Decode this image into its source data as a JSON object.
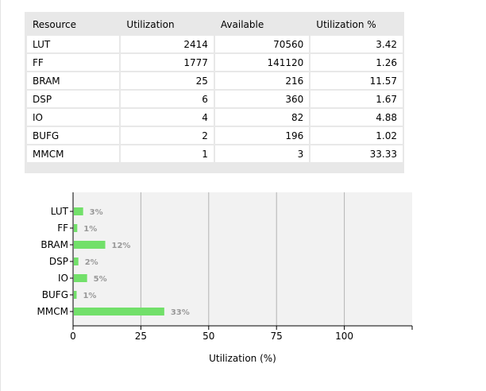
{
  "table": {
    "headers": [
      "Resource",
      "Utilization",
      "Available",
      "Utilization %"
    ],
    "rows": [
      [
        "LUT",
        "2414",
        "70560",
        "3.42"
      ],
      [
        "FF",
        "1777",
        "141120",
        "1.26"
      ],
      [
        "BRAM",
        "25",
        "216",
        "11.57"
      ],
      [
        "DSP",
        "6",
        "360",
        "1.67"
      ],
      [
        "IO",
        "4",
        "82",
        "4.88"
      ],
      [
        "BUFG",
        "2",
        "196",
        "1.02"
      ],
      [
        "MMCM",
        "1",
        "3",
        "33.33"
      ]
    ]
  },
  "chart_data": {
    "type": "bar",
    "orientation": "horizontal",
    "categories": [
      "LUT",
      "FF",
      "BRAM",
      "DSP",
      "IO",
      "BUFG",
      "MMCM"
    ],
    "values": [
      3.42,
      1.26,
      11.57,
      1.67,
      4.88,
      1.02,
      33.33
    ],
    "data_labels": [
      "3%",
      "1%",
      "12%",
      "2%",
      "5%",
      "1%",
      "33%"
    ],
    "xlabel": "Utilization (%)",
    "xlim": [
      0,
      125
    ],
    "xticks": [
      0,
      25,
      50,
      75,
      100
    ],
    "grid": true,
    "bar_color": "#72e06a",
    "label_color": "#999999",
    "plot_background": "#f2f2f2"
  }
}
